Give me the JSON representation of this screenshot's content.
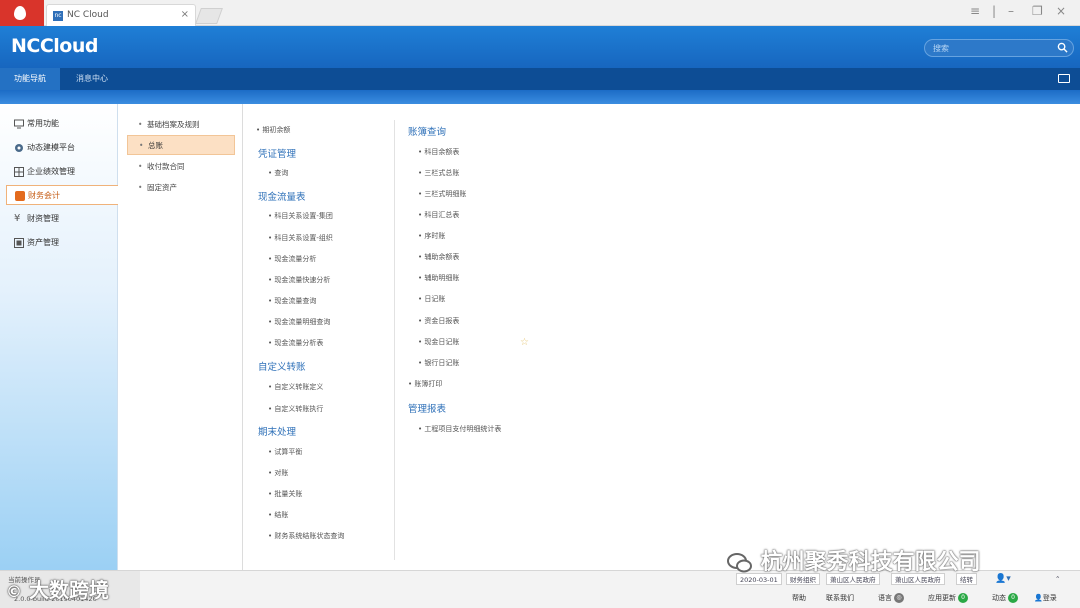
{
  "browser": {
    "tab_title": "NC Cloud",
    "tab_favicon": "nc",
    "close_glyph": "×"
  },
  "header": {
    "brand": "NCCloud",
    "search_placeholder": "搜索"
  },
  "tabs": [
    "功能导航",
    "消息中心"
  ],
  "sidebar": {
    "items": [
      {
        "label": "常用功能",
        "icon": "monitor-icon"
      },
      {
        "label": "动态建模平台",
        "icon": "gear-icon"
      },
      {
        "label": "企业绩效管理",
        "icon": "grid-icon"
      },
      {
        "label": "财务会计",
        "icon": "finance-icon",
        "active": true
      },
      {
        "label": "财资管理",
        "icon": "yen-icon"
      },
      {
        "label": "资产管理",
        "icon": "asset-icon"
      }
    ]
  },
  "subnav": {
    "items": [
      {
        "label": "基础档案及规则"
      },
      {
        "label": "总账",
        "active": true
      },
      {
        "label": "收付款合同"
      },
      {
        "label": "固定资产"
      }
    ]
  },
  "content": {
    "col1": {
      "top_link": "期初余额",
      "sections": [
        {
          "title": "凭证管理",
          "links": [
            "查询"
          ]
        },
        {
          "title": "现金流量表",
          "links": [
            "科目关系设置-集团",
            "科目关系设置-组织",
            "现金流量分析",
            "现金流量快速分析",
            "现金流量查询",
            "现金流量明细查询",
            "现金流量分析表"
          ]
        },
        {
          "title": "自定义转账",
          "links": [
            "自定义转账定义",
            "自定义转账执行"
          ]
        },
        {
          "title": "期末处理",
          "links": [
            "试算平衡",
            "对账",
            "批量关账",
            "结账",
            "财务系统结账状态查询"
          ]
        }
      ]
    },
    "col2": {
      "sections": [
        {
          "title": "账簿查询",
          "links": [
            "科目余额表",
            "三栏式总账",
            "三栏式明细账",
            "科目汇总表",
            "序时账",
            "辅助余额表",
            "辅助明细账",
            "日记账",
            "资金日报表",
            "现金日记账",
            "银行日记账"
          ]
        }
      ],
      "top_link": "账簿打印",
      "sections2": [
        {
          "title": "管理报表",
          "links": [
            "工程项目支付明细统计表"
          ]
        }
      ]
    }
  },
  "status": {
    "left_line1": "当前操作员",
    "left_line2": "2.0.0-build-20190401420",
    "tabs": [
      "2020-03-01",
      "财务组织",
      "萧山区人民政府",
      "萧山区人民政府",
      "结转"
    ],
    "bottom": {
      "help": "帮助",
      "contact": "联系我们",
      "language": "语言",
      "app_update": "应用更新",
      "app_update_count": "0",
      "dynamic": "动态",
      "dynamic_count": "0",
      "login": "登录"
    }
  },
  "watermarks": {
    "right": "杭州聚秀科技有限公司",
    "left": "大数跨境"
  }
}
